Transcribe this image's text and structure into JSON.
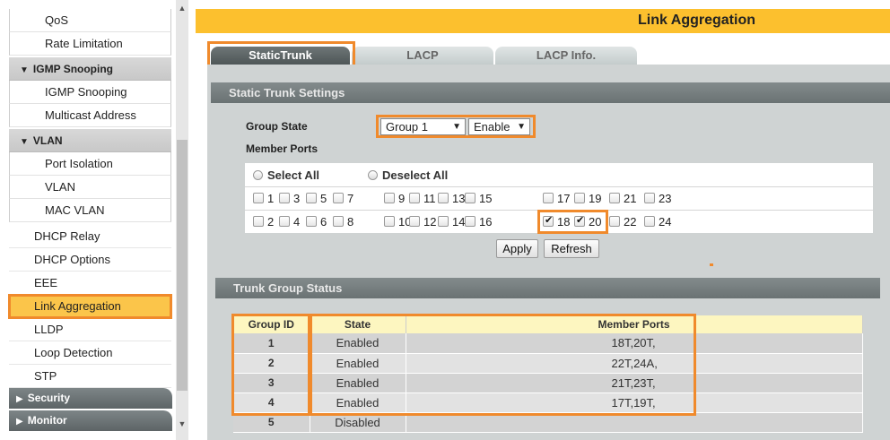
{
  "sidebar": {
    "items": [
      {
        "label": "QoS",
        "kind": "sub"
      },
      {
        "label": "Rate Limitation",
        "kind": "sub"
      },
      {
        "label": "IGMP Snooping",
        "kind": "head"
      },
      {
        "label": "IGMP Snooping",
        "kind": "sub"
      },
      {
        "label": "Multicast Address",
        "kind": "sub"
      },
      {
        "label": "VLAN",
        "kind": "head"
      },
      {
        "label": "Port Isolation",
        "kind": "sub"
      },
      {
        "label": "VLAN",
        "kind": "sub"
      },
      {
        "label": "MAC VLAN",
        "kind": "sub"
      },
      {
        "label": "DHCP Relay",
        "kind": "item"
      },
      {
        "label": "DHCP Options",
        "kind": "item"
      },
      {
        "label": "EEE",
        "kind": "item"
      },
      {
        "label": "Link Aggregation",
        "kind": "item",
        "active": true
      },
      {
        "label": "LLDP",
        "kind": "item"
      },
      {
        "label": "Loop Detection",
        "kind": "item"
      },
      {
        "label": "STP",
        "kind": "item"
      },
      {
        "label": "Security",
        "kind": "dark"
      },
      {
        "label": "Monitor",
        "kind": "dark"
      }
    ]
  },
  "page": {
    "title": "Link Aggregation"
  },
  "tabs": [
    {
      "label": "StaticTrunk",
      "active": true
    },
    {
      "label": "LACP"
    },
    {
      "label": "LACP Info."
    }
  ],
  "static_settings": {
    "section_title": "Static Trunk Settings",
    "group_state_label": "Group State",
    "member_ports_label": "Member Ports",
    "group_select": "Group 1",
    "state_select": "Enable",
    "select_all": "Select All",
    "deselect_all": "Deselect All",
    "ports_row1": [
      "1",
      "3",
      "5",
      "7",
      "9",
      "11",
      "13",
      "15",
      "17",
      "19",
      "21",
      "23"
    ],
    "ports_row2": [
      "2",
      "4",
      "6",
      "8",
      "10",
      "12",
      "14",
      "16",
      "18",
      "20",
      "22",
      "24"
    ],
    "checked_ports": [
      "18",
      "20"
    ],
    "apply_label": "Apply",
    "refresh_label": "Refresh"
  },
  "trunk_status": {
    "section_title": "Trunk Group Status",
    "columns": [
      "Group ID",
      "State",
      "Member Ports"
    ],
    "rows": [
      {
        "id": "1",
        "state": "Enabled",
        "members": "18T,20T,"
      },
      {
        "id": "2",
        "state": "Enabled",
        "members": "22T,24A,"
      },
      {
        "id": "3",
        "state": "Enabled",
        "members": "21T,23T,"
      },
      {
        "id": "4",
        "state": "Enabled",
        "members": "17T,19T,"
      },
      {
        "id": "5",
        "state": "Disabled",
        "members": ""
      }
    ]
  },
  "colors": {
    "accent": "#fcc02e",
    "highlight": "#f08a2c",
    "section": "#6a7273"
  }
}
